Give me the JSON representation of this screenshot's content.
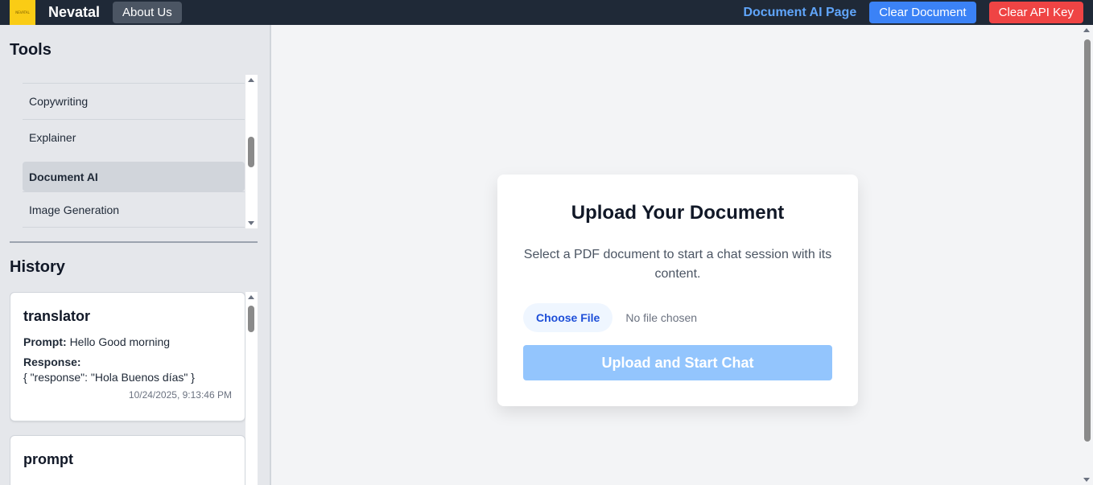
{
  "navbar": {
    "logo_text": "NEVATAL",
    "brand": "Nevatal",
    "about_label": "About Us",
    "page_label": "Document AI Page",
    "clear_document_label": "Clear Document",
    "clear_api_key_label": "Clear API Key"
  },
  "sidebar": {
    "tools_title": "Tools",
    "tools": [
      {
        "label": "Copywriting"
      },
      {
        "label": "Explainer"
      },
      {
        "label": "Document AI",
        "active": true
      },
      {
        "label": "Image Generation"
      }
    ],
    "history_title": "History",
    "history": [
      {
        "title": "translator",
        "prompt_label": "Prompt:",
        "prompt": "Hello Good morning",
        "response_label": "Response:",
        "response": "{ \"response\": \"Hola Buenos días\" }",
        "timestamp": "10/24/2025, 9:13:46 PM"
      },
      {
        "title": "prompt"
      }
    ]
  },
  "upload": {
    "title": "Upload Your Document",
    "description": "Select a PDF document to start a chat session with its content.",
    "choose_file_label": "Choose File",
    "file_status": "No file chosen",
    "submit_label": "Upload and Start Chat"
  },
  "colors": {
    "navbar_bg": "#1f2937",
    "accent_blue": "#3b82f6",
    "danger_red": "#ef4444",
    "logo_yellow": "#facc15",
    "disabled_button": "#93c5fd"
  },
  "icons": [
    "scroll-up-arrow-icon",
    "scroll-down-arrow-icon"
  ]
}
